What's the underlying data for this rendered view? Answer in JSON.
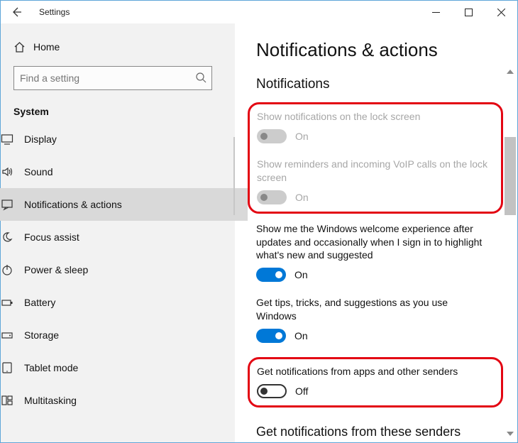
{
  "window": {
    "title": "Settings"
  },
  "sidebar": {
    "home": "Home",
    "search_placeholder": "Find a setting",
    "category": "System",
    "items": [
      {
        "label": "Display"
      },
      {
        "label": "Sound"
      },
      {
        "label": "Notifications & actions"
      },
      {
        "label": "Focus assist"
      },
      {
        "label": "Power & sleep"
      },
      {
        "label": "Battery"
      },
      {
        "label": "Storage"
      },
      {
        "label": "Tablet mode"
      },
      {
        "label": "Multitasking"
      }
    ]
  },
  "main": {
    "heading": "Notifications & actions",
    "section": "Notifications",
    "settings": [
      {
        "label": "Show notifications on the lock screen",
        "state": "On"
      },
      {
        "label": "Show reminders and incoming VoIP calls on the lock screen",
        "state": "On"
      },
      {
        "label": "Show me the Windows welcome experience after updates and occasionally when I sign in to highlight what's new and suggested",
        "state": "On"
      },
      {
        "label": "Get tips, tricks, and suggestions as you use Windows",
        "state": "On"
      },
      {
        "label": "Get notifications from apps and other senders",
        "state": "Off"
      }
    ],
    "senders_heading": "Get notifications from these senders"
  }
}
